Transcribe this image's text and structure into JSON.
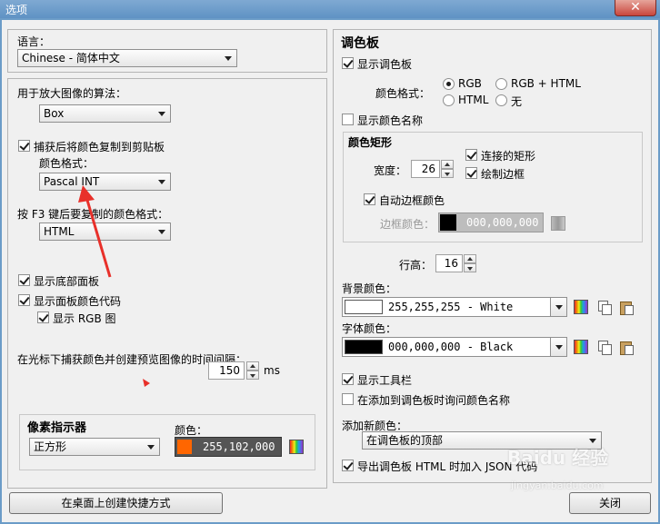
{
  "window": {
    "title": "选项",
    "close_label": "✕"
  },
  "left": {
    "language": {
      "label": "语言：",
      "value": "Chinese - 简体中文"
    },
    "zoom": {
      "label": "用于放大图像的算法：",
      "value": "Box"
    },
    "copy_after_capture": {
      "label": "捕获后将颜色复制到剪贴板",
      "checked": true
    },
    "copy_format": {
      "label": "颜色格式：",
      "value": "Pascal INT"
    },
    "f3_format": {
      "label": "按 F3 键后要复制的颜色格式：",
      "value": "HTML"
    },
    "show_bottom_panel": {
      "label": "显示底部面板",
      "checked": true
    },
    "show_panel_color_code": {
      "label": "显示面板颜色代码",
      "checked": true
    },
    "show_rgb_chart": {
      "label": "显示 RGB 图",
      "checked": true
    },
    "interval": {
      "label": "在光标下捕获颜色并创建预览图像的时间间隔：",
      "value": "150",
      "unit": "ms"
    },
    "pixel_indicator": {
      "title": "像素指示器",
      "shape_value": "正方形",
      "color_label": "颜色：",
      "color_value": "255,102,000",
      "color_hex": "#ff6600"
    },
    "shortcut_button": "在桌面上创建快捷方式"
  },
  "right": {
    "title": "调色板",
    "show_palette": {
      "label": "显示调色板",
      "checked": true
    },
    "color_format": {
      "label": "颜色格式：",
      "options": [
        "RGB",
        "RGB + HTML",
        "HTML",
        "无"
      ],
      "selected": "RGB"
    },
    "show_color_names": {
      "label": "显示颜色名称",
      "checked": false
    },
    "rects": {
      "title": "颜色矩形",
      "width_label": "宽度：",
      "width_value": "26",
      "connected": {
        "label": "连接的矩形",
        "checked": true
      },
      "draw_border": {
        "label": "绘制边框",
        "checked": true
      },
      "auto_border": {
        "label": "自动边框颜色",
        "checked": true
      },
      "border_color_label": "边框颜色：",
      "border_color_value": "000,000,000"
    },
    "row_height": {
      "label": "行高：",
      "value": "16"
    },
    "bg_color": {
      "label": "背景颜色：",
      "value": "255,255,255 - White",
      "hex": "#ffffff"
    },
    "font_color": {
      "label": "字体颜色：",
      "value": "000,000,000 - Black",
      "hex": "#000000"
    },
    "show_toolbar": {
      "label": "显示工具栏",
      "checked": true
    },
    "ask_name": {
      "label": "在添加到调色板时询问颜色名称",
      "checked": false
    },
    "add_new": {
      "label": "添加新颜色：",
      "value": "在调色板的顶部"
    },
    "export_json": {
      "label": "导出调色板 HTML 时加入 JSON 代码",
      "checked": true
    },
    "close_button": "关闭"
  },
  "watermark": {
    "line1": "Baidu 经验",
    "line2": "jingyan.baidu.com"
  },
  "colors": {
    "annotation_red": "#e8302a",
    "title_bar": "#6b9cc8"
  }
}
